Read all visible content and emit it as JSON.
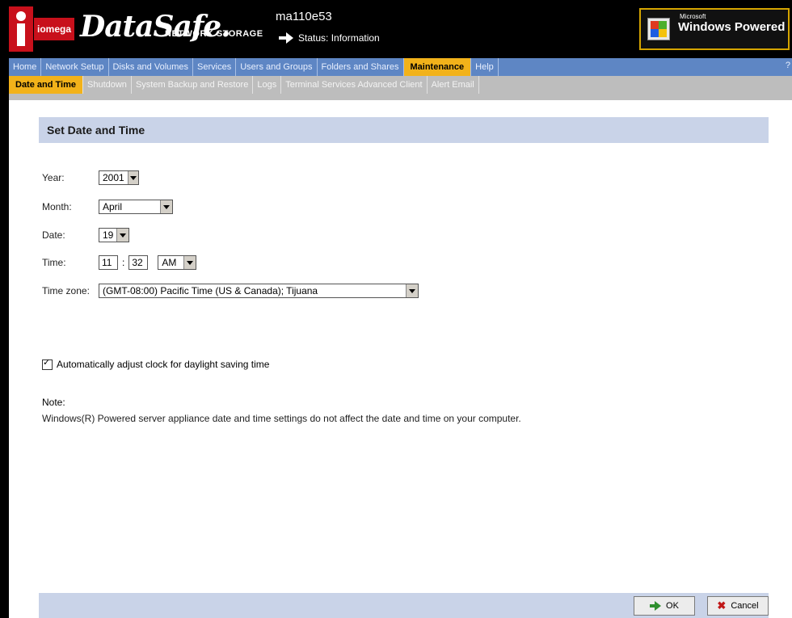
{
  "header": {
    "logo_text": "iomega",
    "brand": "DataSafe.",
    "brand_sub": "NETWORK STORAGE",
    "host": "ma110e53",
    "status": "Status: Information",
    "ms_small": "Microsoft",
    "ms_big": "Windows Powered"
  },
  "nav": {
    "main": [
      "Home",
      "Network Setup",
      "Disks and Volumes",
      "Services",
      "Users and Groups",
      "Folders and Shares",
      "Maintenance",
      "Help"
    ],
    "help_q": "?",
    "sub": [
      "Date and Time",
      "Shutdown",
      "System Backup and Restore",
      "Logs",
      "Terminal Services Advanced Client",
      "Alert Email"
    ]
  },
  "panel": {
    "title": "Set Date and Time"
  },
  "form": {
    "year_label": "Year:",
    "year_value": "2001",
    "month_label": "Month:",
    "month_value": "April",
    "date_label": "Date:",
    "date_value": "19",
    "time_label": "Time:",
    "hour": "11",
    "minute": "32",
    "ampm": "AM",
    "tz_label": "Time zone:",
    "tz_value": "(GMT-08:00) Pacific Time (US & Canada); Tijuana"
  },
  "dst": {
    "label": "Automatically adjust clock for daylight saving time",
    "checked": true
  },
  "note": {
    "heading": "Note:",
    "text": "Windows(R) Powered server appliance date and time settings do not affect the date and time on your computer."
  },
  "footer": {
    "ok": "OK",
    "cancel": "Cancel"
  }
}
